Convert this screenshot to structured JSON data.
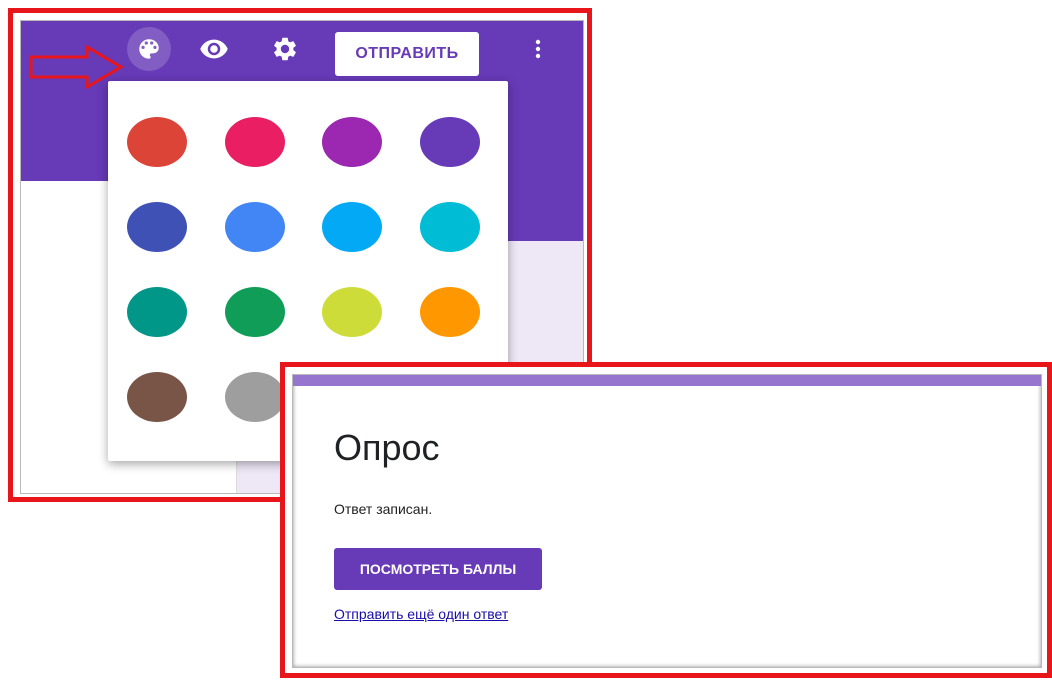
{
  "editor": {
    "toolbar": {
      "icons": {
        "palette": "palette-icon",
        "preview": "eye-icon",
        "settings": "gear-icon",
        "more": "more-vert-icon"
      },
      "send_label": "ОТПРАВИТЬ"
    },
    "color_palette": {
      "swatches": [
        "#db4437",
        "#e91e63",
        "#9c27b0",
        "#673ab7",
        "#3f51b5",
        "#4285f4",
        "#03a9f4",
        "#00bcd4",
        "#009688",
        "#0f9d58",
        "#cddc39",
        "#ff9800",
        "#795548",
        "#9e9e9e"
      ]
    }
  },
  "response": {
    "title": "Опрос",
    "message": "Ответ записан.",
    "view_score_label": "ПОСМОТРЕТЬ БАЛЛЫ",
    "submit_another_label": "Отправить ещё один ответ"
  },
  "colors": {
    "accent": "#673ab7",
    "accent_light": "#9575cd",
    "annotation": "#e8151b",
    "background_tint": "#ede7f6"
  }
}
